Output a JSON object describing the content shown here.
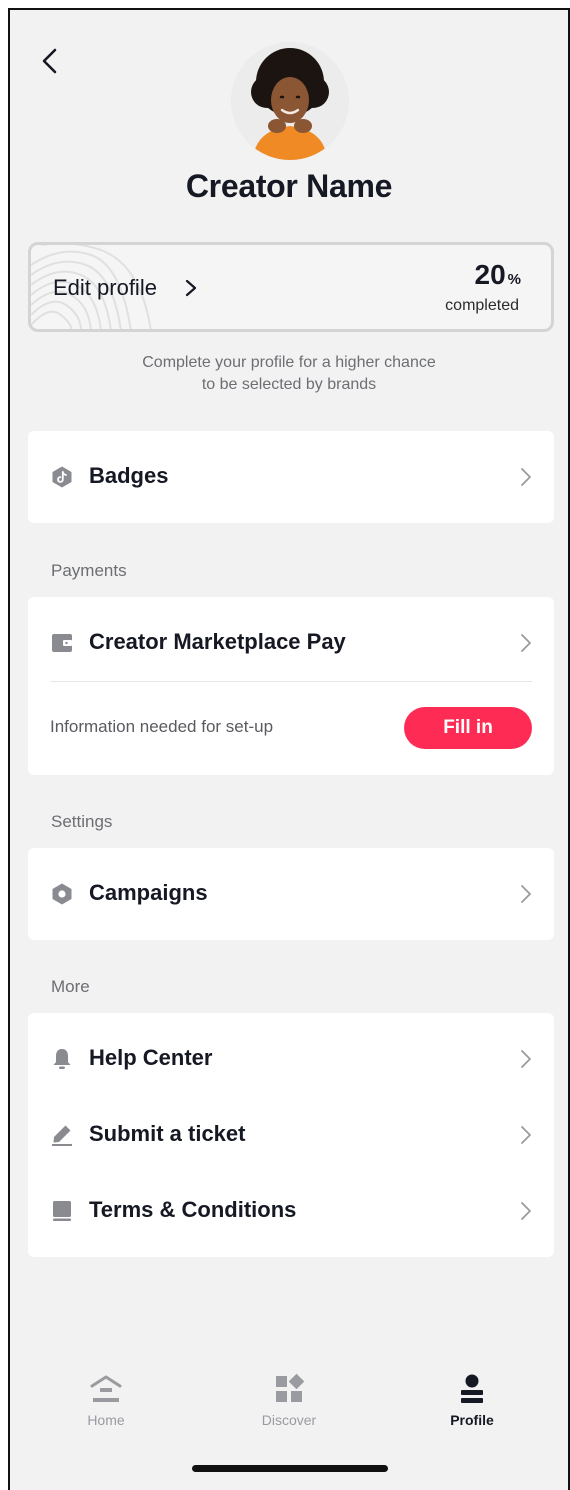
{
  "profile": {
    "name": "Creator Name",
    "edit_label": "Edit profile",
    "completion_value": "20",
    "completion_sign": "%",
    "completion_label": "completed",
    "completion_fraction": 0.2,
    "helper_line1": "Complete your profile for a higher chance",
    "helper_line2": "to be selected by brands"
  },
  "badges": {
    "label": "Badges"
  },
  "payments": {
    "section_title": "Payments",
    "item_label": "Creator Marketplace Pay",
    "info_text": "Information needed for set-up",
    "button_label": "Fill in"
  },
  "settings": {
    "section_title": "Settings",
    "item_label": "Campaigns"
  },
  "more": {
    "section_title": "More",
    "items": [
      {
        "label": "Help Center",
        "icon": "bell-icon"
      },
      {
        "label": "Submit a ticket",
        "icon": "pencil-icon"
      },
      {
        "label": "Terms & Conditions",
        "icon": "book-icon"
      }
    ]
  },
  "tabbar": {
    "tabs": [
      {
        "label": "Home",
        "icon": "home-icon",
        "active": false
      },
      {
        "label": "Discover",
        "icon": "discover-icon",
        "active": false
      },
      {
        "label": "Profile",
        "icon": "profile-icon",
        "active": true
      }
    ]
  },
  "colors": {
    "accent": "#fe2c55",
    "background": "#f2f2f2",
    "card": "#ffffff",
    "icon_gray": "#8a8b91"
  }
}
